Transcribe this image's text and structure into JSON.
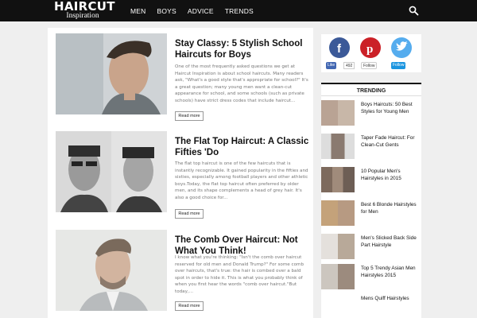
{
  "header": {
    "logo_main": "HAIRCUT",
    "logo_sub": "Inspiration",
    "nav": [
      "MEN",
      "BOYS",
      "ADVICE",
      "TRENDS"
    ]
  },
  "posts": [
    {
      "title": "Stay Classy: 5 Stylish School Haircuts for Boys",
      "excerpt": "One of the most frequently asked questions we get at Haircut Inspiration is about school haircuts. Many readers ask, \"What's a good style that's appropriate for school?\" It's a great question; many young men want a clean-cut appearance for school, and some schools (such as private schools) have strict dress codes that include haircut...",
      "read_more": "Read more"
    },
    {
      "title": "The Flat Top Haircut: A Classic Fifties 'Do",
      "excerpt": "The flat top haircut is one of the few haircuts that is instantly recognizable. It gained popularity in the fifties and sixties, especially among football players and other athletic boys.Today, the flat top haircut often preferred by older men, and its shape complements a head of grey hair. It's also a good choice for...",
      "read_more": "Read more"
    },
    {
      "title": "The Comb Over Haircut: Not What You Think!",
      "excerpt": "I know what you're thinking: \"Isn't the comb over haircut reserved for old men and Donald Trump?\" For some comb over haircuts, that's true: the hair is combed over a bald spot in order to hide it. This is what you probably think of when you first hear the words \"comb over haircut.\"But today,...",
      "read_more": "Read more"
    }
  ],
  "social": {
    "facebook_like": "Like",
    "facebook_count": "492",
    "pinterest_follow": "Follow",
    "twitter_follow": "Follow"
  },
  "trending": {
    "heading": "TRENDING",
    "items": [
      "Boys Haircuts: 50 Best Styles for Young Men",
      "Taper Fade Haircut: For Clean-Cut Gents",
      "10 Popular Men's Hairstyles in 2015",
      "Best 6 Blonde Hairstyles for Men",
      "Men's Slicked Back Side Part Hairstyle",
      "Top 5 Trendy Asian Men Hairstyles 2015",
      "Mens Quiff Hairstyles"
    ]
  },
  "colors": {
    "topbar": "#111111",
    "facebook": "#3b5998",
    "pinterest": "#cb2027",
    "twitter": "#55acee"
  }
}
